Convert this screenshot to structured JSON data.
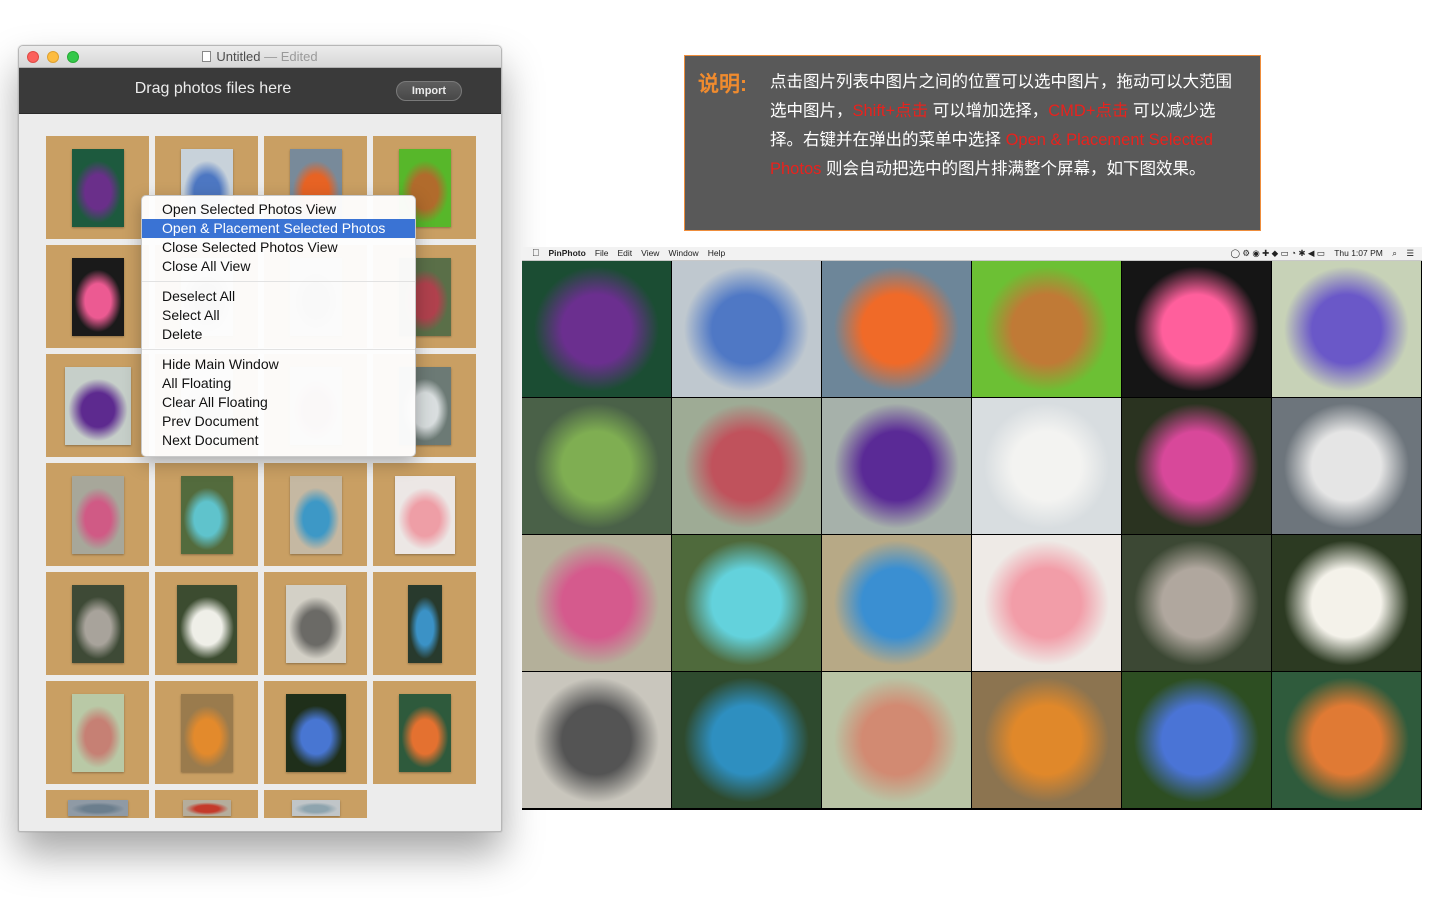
{
  "app_window": {
    "title": "Untitled",
    "title_suffix": "— Edited",
    "drop_label": "Drag photos files here",
    "import_label": "Import",
    "cell_color": "#c99f63"
  },
  "context_menu": {
    "groups": [
      [
        {
          "label": "Open Selected Photos View",
          "selected": false
        },
        {
          "label": "Open & Placement Selected Photos",
          "selected": true
        },
        {
          "label": "Close Selected Photos View",
          "selected": false
        },
        {
          "label": "Close All View",
          "selected": false
        }
      ],
      [
        {
          "label": "Deselect All",
          "selected": false
        },
        {
          "label": "Select All",
          "selected": false
        },
        {
          "label": "Delete",
          "selected": false
        }
      ],
      [
        {
          "label": "Hide Main Window",
          "selected": false
        },
        {
          "label": "All Floating",
          "selected": false
        },
        {
          "label": "Clear All Floating",
          "selected": false
        },
        {
          "label": "Prev Document",
          "selected": false
        },
        {
          "label": "Next Document",
          "selected": false
        }
      ]
    ]
  },
  "note": {
    "label": "说明:",
    "segments": [
      {
        "text": "点击图片列表中图片之间的位置可以选中图片，拖动可以大范围选中图片，",
        "red": false
      },
      {
        "text": "Shift+点击",
        "red": true
      },
      {
        "text": " 可以增加选择，",
        "red": false
      },
      {
        "text": "CMD+点击",
        "red": true
      },
      {
        "text": " 可以减少选择。右键并在弹出的菜单中选择 ",
        "red": false
      },
      {
        "text": "Open & Placement Selected Photos",
        "red": true
      },
      {
        "text": " 则会自动把选中的图片排满整个屏幕，如下图效果。",
        "red": false
      }
    ]
  },
  "result_screen": {
    "menubar": {
      "left": [
        "PinPhoto",
        "File",
        "Edit",
        "View",
        "Window",
        "Help"
      ],
      "right": [
        "Thu 1:07 PM"
      ]
    }
  },
  "thumbnails": [
    {
      "bg": "#1d5a3e",
      "fg": "#6a2f8a",
      "w": 52,
      "h": 78
    },
    {
      "bg": "#c8d2da",
      "fg": "#4d77c2",
      "w": 52,
      "h": 78
    },
    {
      "bg": "#788a9a",
      "fg": "#e76324",
      "w": 52,
      "h": 78
    },
    {
      "bg": "#57b72a",
      "fg": "#b16b2c",
      "w": 52,
      "h": 78
    },
    {
      "bg": "#1a1a1a",
      "fg": "#ec5a92",
      "w": 52,
      "h": 78
    },
    {
      "bg": "#c9c9c9",
      "fg": "#8c8c8c",
      "w": 52,
      "h": 78
    },
    {
      "bg": "#bbbbbb",
      "fg": "#888888",
      "w": 52,
      "h": 78
    },
    {
      "bg": "#5a6f48",
      "fg": "#b0414d",
      "w": 52,
      "h": 78
    },
    {
      "bg": "#c6cfc9",
      "fg": "#5d2a8f",
      "w": 66,
      "h": 78
    },
    {
      "bg": "#cfcfcf",
      "fg": "#aaaaaa",
      "w": 52,
      "h": 78
    },
    {
      "bg": "#bcbcbc",
      "fg": "#a56070",
      "w": 52,
      "h": 78
    },
    {
      "bg": "#6c7a75",
      "fg": "#d9dedf",
      "w": 52,
      "h": 78
    },
    {
      "bg": "#a7a79a",
      "fg": "#d05a85",
      "w": 52,
      "h": 78
    },
    {
      "bg": "#536b3d",
      "fg": "#5fc3cc",
      "w": 52,
      "h": 78
    },
    {
      "bg": "#c5b8a2",
      "fg": "#3d98c6",
      "w": 52,
      "h": 78
    },
    {
      "bg": "#ece7e5",
      "fg": "#ee9ea6",
      "w": 60,
      "h": 78
    },
    {
      "bg": "#3e4a36",
      "fg": "#a8a39b",
      "w": 52,
      "h": 78
    },
    {
      "bg": "#3c4c30",
      "fg": "#efefe8",
      "w": 60,
      "h": 78
    },
    {
      "bg": "#d3d0c6",
      "fg": "#6b6a66",
      "w": 60,
      "h": 78
    },
    {
      "bg": "#283a2d",
      "fg": "#3b92c6",
      "w": 34,
      "h": 78
    },
    {
      "bg": "#b9c9a6",
      "fg": "#c68074",
      "w": 52,
      "h": 78
    },
    {
      "bg": "#9a7b4d",
      "fg": "#e38a2c",
      "w": 52,
      "h": 78
    },
    {
      "bg": "#1f2f1a",
      "fg": "#4876d2",
      "w": 60,
      "h": 78
    },
    {
      "bg": "#2e5a3c",
      "fg": "#e47130",
      "w": 52,
      "h": 78
    },
    {
      "bg": "#8f9aa5",
      "fg": "#6b7e8d",
      "w": 60,
      "h": 16
    },
    {
      "bg": "#b5ad9c",
      "fg": "#c43a2b",
      "w": 48,
      "h": 16
    },
    {
      "bg": "#c0c5c8",
      "fg": "#8ea4ae",
      "w": 48,
      "h": 16
    }
  ],
  "result_tiles": [
    {
      "bg": "#1b4d33",
      "fg": "#6b2f8f"
    },
    {
      "bg": "#bfc8cf",
      "fg": "#4f78c5"
    },
    {
      "bg": "#6d8699",
      "fg": "#f06a28"
    },
    {
      "bg": "#6cc034",
      "fg": "#c07a36"
    },
    {
      "bg": "#151515",
      "fg": "#ff5f9c"
    },
    {
      "bg": "#c7d2b7",
      "fg": "#6a58c8"
    },
    {
      "bg": "#4a6148",
      "fg": "#7fae52"
    },
    {
      "bg": "#9eab95",
      "fg": "#c0525c"
    },
    {
      "bg": "#a6b1aa",
      "fg": "#5a2a96"
    },
    {
      "bg": "#d8dde0",
      "fg": "#f3f3f1"
    },
    {
      "bg": "#2a3320",
      "fg": "#d8489a"
    },
    {
      "bg": "#6d757c",
      "fg": "#e5e5e5"
    },
    {
      "bg": "#b4b09a",
      "fg": "#d55a8d"
    },
    {
      "bg": "#4f6a3c",
      "fg": "#63d2dc"
    },
    {
      "bg": "#b7a986",
      "fg": "#3a8fd2"
    },
    {
      "bg": "#eeeae6",
      "fg": "#f29da8"
    },
    {
      "bg": "#3c4834",
      "fg": "#b0a79e"
    },
    {
      "bg": "#2c3a22",
      "fg": "#f4f2ea"
    },
    {
      "bg": "#c9c6bd",
      "fg": "#545454"
    },
    {
      "bg": "#2e4a2e",
      "fg": "#2e8fc0"
    },
    {
      "bg": "#b9c4a5",
      "fg": "#d28a72"
    },
    {
      "bg": "#8c7450",
      "fg": "#e0882a"
    },
    {
      "bg": "#2d4e22",
      "fg": "#4a74d6"
    },
    {
      "bg": "#2f5b3c",
      "fg": "#e07a34"
    }
  ]
}
